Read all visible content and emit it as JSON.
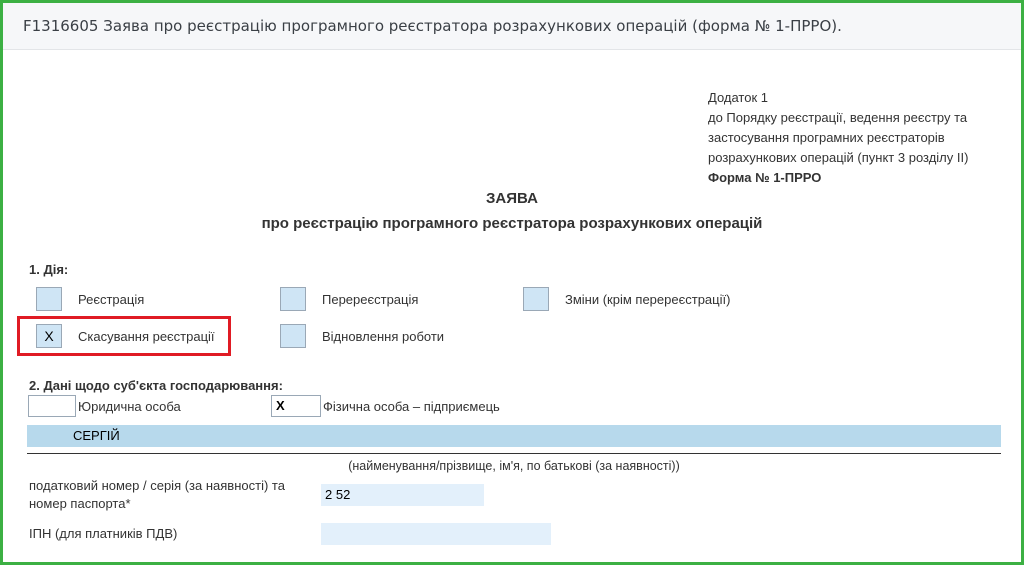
{
  "header": {
    "title": "F1316605 Заява про реєстрацію програмного реєстратора розрахункових операцій (форма № 1-ПРРО)."
  },
  "annex": {
    "line1": "Додаток 1",
    "line2": "до Порядку реєстрації, ведення реєстру та",
    "line3": "застосування програмних реєстраторів",
    "line4": "розрахункових операцій (пункт 3 розділу ІІ)",
    "form": "Форма № 1-ПРРО"
  },
  "document": {
    "title": "ЗАЯВА",
    "subtitle": "про реєстрацію програмного реєстратора розрахункових операцій"
  },
  "section1": {
    "label": "1. Дія:",
    "options": {
      "registration": {
        "label": "Реєстрація",
        "mark": ""
      },
      "reregistration": {
        "label": "Перереєстрація",
        "mark": ""
      },
      "changes": {
        "label": "Зміни (крім перереєстрації)",
        "mark": ""
      },
      "cancel": {
        "label": "Скасування реєстрації",
        "mark": "Х"
      },
      "restore": {
        "label": "Відновлення роботи",
        "mark": ""
      }
    }
  },
  "section2": {
    "label": "2. Дані щодо суб'єкта господарювання:",
    "legal": {
      "label": "Юридична особа",
      "mark": ""
    },
    "individual": {
      "label": "Фізична особа – підприємець",
      "mark": "Х"
    },
    "name_value": "СЕРГІЙ",
    "name_caption": "(найменування/прізвище, ім'я, по батькові (за наявності))",
    "tax_label": "податковий номер / серія (за наявності) та номер паспорта*",
    "tax_value": "2       52",
    "ipn_label": "ІПН (для платників ПДВ)",
    "ipn_value": ""
  }
}
